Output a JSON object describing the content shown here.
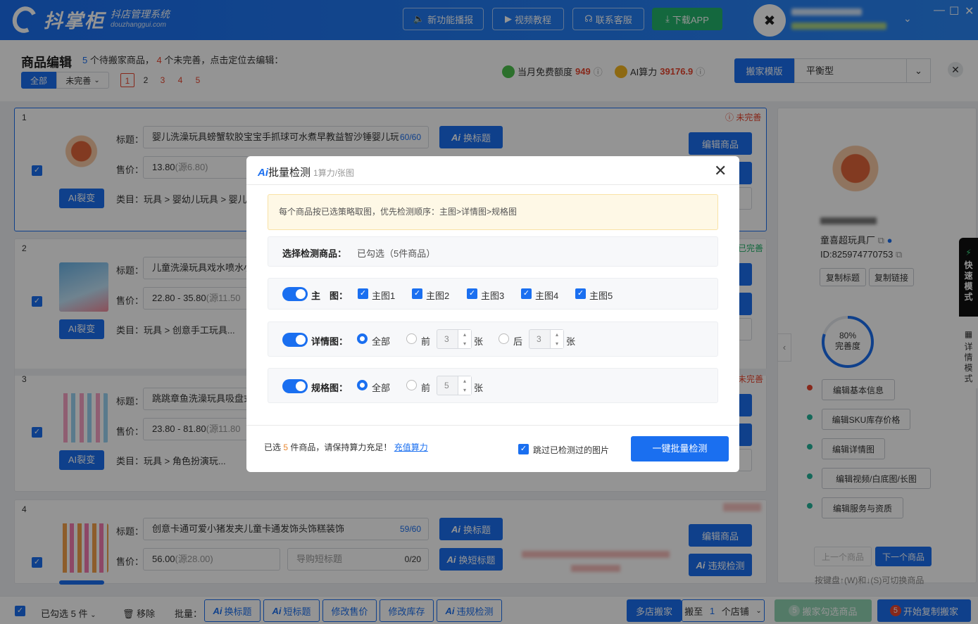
{
  "app": {
    "name": "抖掌柜",
    "subtitle": "抖店管理系统",
    "domain": "douzhanggui.com"
  },
  "topbar": {
    "btn_news": "新功能播报",
    "btn_video": "视频教程",
    "btn_service": "联系客服",
    "btn_download": "下载APP"
  },
  "header": {
    "title": "商品编辑",
    "pending_count": "5",
    "pending_text": "个待搬家商品，",
    "incomplete_count": "4",
    "incomplete_text": "个未完善，点击定位去编辑：",
    "filter_all": "全部",
    "filter_incomplete": "未完善",
    "pages": [
      "1",
      "2",
      "3",
      "4",
      "5"
    ],
    "free_quota_label": "当月免费额度",
    "free_quota_value": "949",
    "ai_label": "AI算力",
    "ai_value": "39176.9",
    "template_btn": "搬家模版",
    "template_value": "平衡型"
  },
  "products": [
    {
      "num": "1",
      "status": "未完善",
      "title_label": "标题：",
      "title_value": "婴儿洗澡玩具螃蟹软胶宝宝手抓球可水煮早教益智沙锤婴儿玩",
      "title_count": "60/60",
      "price_label": "售价：",
      "price_value": "13.80",
      "price_src": "(源6.80)",
      "category_label": "类目：",
      "category": "玩具 > 婴幼儿玩具 > 婴儿",
      "ai_split": "AI裂变",
      "btn_title": "换标题",
      "btn_edit": "编辑商品"
    },
    {
      "num": "2",
      "status": "已完善",
      "title_label": "标题：",
      "title_value": "儿童洗澡玩具戏水喷水小车diy",
      "price_label": "售价：",
      "price_value": "22.80 - 35.80",
      "price_src": "(源11.50",
      "category_label": "类目：",
      "category": "玩具 > 创意手工玩具...",
      "ai_split": "AI裂变"
    },
    {
      "num": "3",
      "status": "未完善",
      "title_label": "标题：",
      "title_value": "跳跳章鱼洗澡玩具吸盘式",
      "price_label": "售价：",
      "price_value": "23.80 - 81.80",
      "price_src": "(源11.80",
      "category_label": "类目：",
      "category": "玩具 > 角色扮演玩...",
      "ai_split": "AI裂变"
    },
    {
      "num": "4",
      "title_label": "标题：",
      "title_value": "创意卡通可爱小猪发夹儿童卡通发饰头饰糕装饰",
      "title_count": "59/60",
      "price_label": "售价：",
      "price_value": "56.00",
      "price_src": "(源28.00)",
      "short_title_placeholder": "导购短标题",
      "short_count": "0/20",
      "btn_title": "换标题",
      "btn_short": "换短标题",
      "btn_edit": "编辑商品",
      "btn_check": "违规检测"
    }
  ],
  "sidebar": {
    "shop_name": "童喜超玩具厂",
    "shop_id": "ID:825974770753",
    "btn_copy_title": "复制标题",
    "btn_copy_link": "复制链接",
    "progress_pct": "80%",
    "progress_label": "完善度",
    "progress_value": 0.8,
    "edit_items": [
      "编辑基本信息",
      "编辑SKU库存价格",
      "编辑详情图",
      "编辑视频/白底图/长图",
      "编辑服务与资质"
    ],
    "prev": "上一个商品",
    "next": "下一个商品",
    "hint": "按键盘↑(W)和↓(S)可切换商品",
    "tab_fast": "快速模式",
    "tab_detail": "详情模式"
  },
  "bottom": {
    "selected": "已勾选 5 件",
    "remove": "移除",
    "batch_label": "批量：",
    "b_title": "换标题",
    "b_short": "短标题",
    "b_price": "修改售价",
    "b_stock": "修改库存",
    "b_check": "违规检测",
    "multi_shop": "多店搬家",
    "move_to": "搬至",
    "move_count": "1",
    "move_unit": "个店铺",
    "move_selected": "搬家勾选商品",
    "start_copy": "开始复制搬家",
    "badge": "5"
  },
  "modal": {
    "title": "批量检测",
    "subtitle": "1算力/张图",
    "notice": "每个商品按已选策略取图，优先检测顺序：主图>详情图>规格图",
    "select_label": "选择检测商品：",
    "select_value": "已勾选（5件商品）",
    "main_label": "主　图：",
    "main_options": [
      "主图1",
      "主图2",
      "主图3",
      "主图4",
      "主图5"
    ],
    "detail_label": "详情图：",
    "all": "全部",
    "front": "前",
    "back": "后",
    "front_val": "3",
    "back_val": "3",
    "unit": "张",
    "spec_label": "规格图：",
    "spec_val": "5",
    "footer_prefix": "已选",
    "footer_count": "5",
    "footer_suffix": "件商品，请保持算力充足！",
    "recharge": "充值算力",
    "skip_checked": "跳过已检测过的图片",
    "start": "一键批量检测"
  },
  "colors": {
    "primary": "#1a6ff0",
    "danger": "#e8462f",
    "success": "#23b46b"
  }
}
